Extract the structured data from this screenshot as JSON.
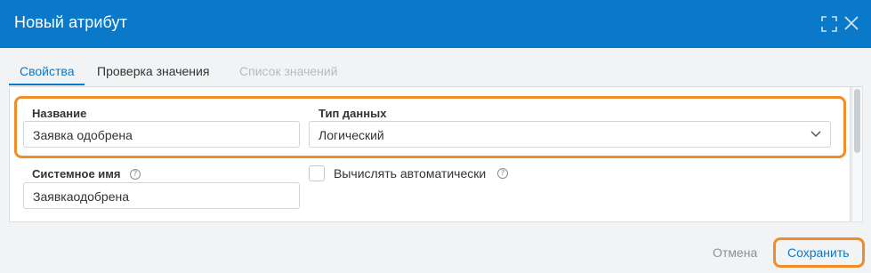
{
  "dialog": {
    "title": "Новый атрибут",
    "expand_icon": "expand-icon",
    "close_icon": "close-icon"
  },
  "tabs": [
    {
      "label": "Свойства",
      "state": "active"
    },
    {
      "label": "Проверка значения",
      "state": "normal"
    },
    {
      "label": "Список значений",
      "state": "disabled"
    }
  ],
  "form": {
    "name": {
      "label": "Название",
      "value": "Заявка одобрена"
    },
    "data_type": {
      "label": "Тип данных",
      "value": "Логический"
    },
    "system_name": {
      "label": "Системное имя",
      "value": "Заявкаодобрена"
    },
    "auto_compute": {
      "label": "Вычислять автоматически",
      "checked": false
    }
  },
  "footer": {
    "cancel_label": "Отмена",
    "save_label": "Сохранить"
  },
  "colors": {
    "header": "#0b79c9",
    "accent": "#0b79c9",
    "highlight": "#f28c28"
  }
}
